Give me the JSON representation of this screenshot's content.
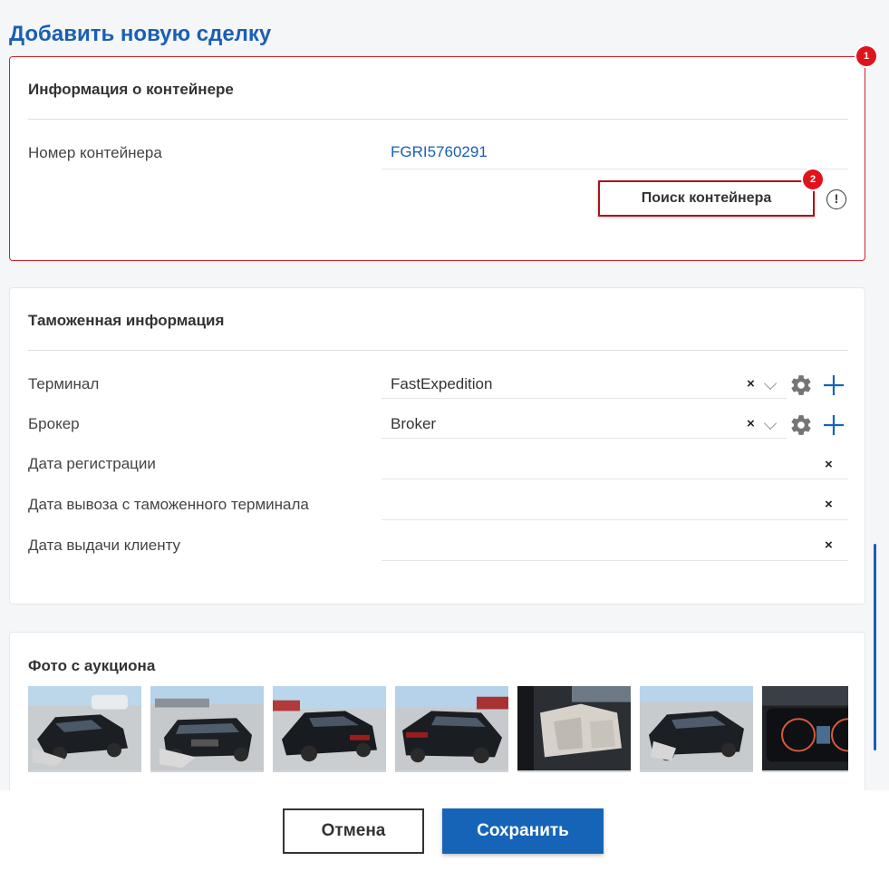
{
  "page": {
    "title": "Добавить новую сделку"
  },
  "container_section": {
    "title": "Информация о контейнере",
    "number_label": "Номер контейнера",
    "number_value": "FGRI5760291",
    "search_button": "Поиск контейнера",
    "info_icon": "!",
    "badge_section": "1",
    "badge_button": "2"
  },
  "customs_section": {
    "title": "Таможенная информация",
    "rows": [
      {
        "label": "Терминал",
        "value": "FastExpedition"
      },
      {
        "label": "Брокер",
        "value": "Broker"
      },
      {
        "label": "Дата регистрации",
        "value": ""
      },
      {
        "label": "Дата вывоза с таможенного терминала",
        "value": ""
      },
      {
        "label": "Дата выдачи клиенту",
        "value": ""
      }
    ],
    "clear_symbol": "×"
  },
  "photos_section": {
    "title": "Фото с аукциона",
    "photos": [
      {
        "icon": "car-photo-front-damaged"
      },
      {
        "icon": "car-photo-front"
      },
      {
        "icon": "car-photo-rear-left"
      },
      {
        "icon": "car-photo-rear-right"
      },
      {
        "icon": "car-photo-interior"
      },
      {
        "icon": "car-photo-front-side"
      },
      {
        "icon": "car-photo-dashboard"
      }
    ]
  },
  "footer": {
    "cancel_label": "Отмена",
    "save_label": "Сохранить"
  },
  "colors": {
    "accent": "#1664b8",
    "title_blue": "#1a5fb4",
    "highlight_red": "#d21f2b",
    "badge_red": "#e0131d"
  }
}
